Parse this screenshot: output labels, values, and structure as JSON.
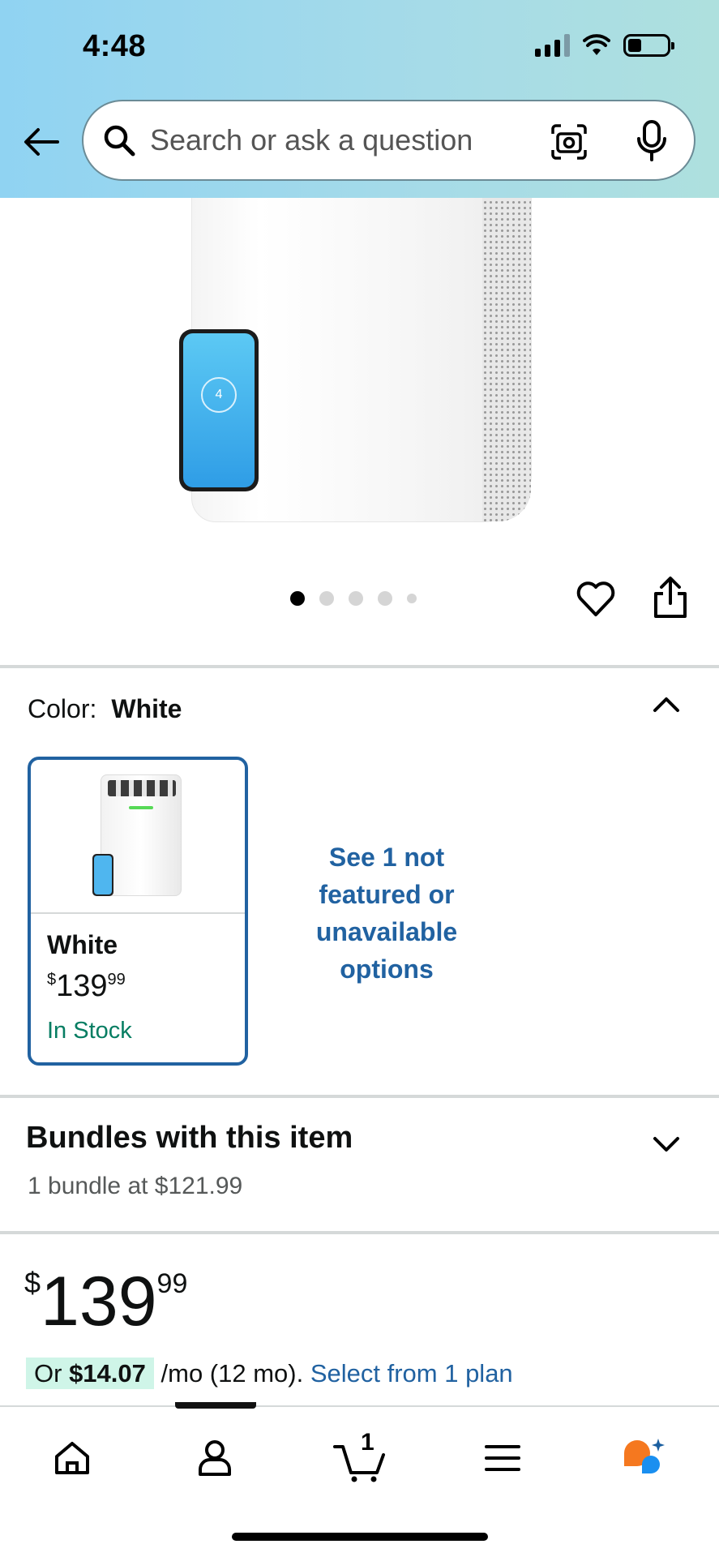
{
  "status_bar": {
    "time": "4:48"
  },
  "search": {
    "placeholder": "Search or ask a question"
  },
  "gallery": {
    "image_count": 5,
    "active_index": 0,
    "phone_reading": "4"
  },
  "color_section": {
    "label": "Color:",
    "selected": "White",
    "options": [
      {
        "name": "White",
        "price_whole": "139",
        "price_cents": "99",
        "price_currency": "$",
        "availability": "In Stock"
      }
    ],
    "see_more": "See 1 not featured or unavailable options"
  },
  "bundles": {
    "title": "Bundles with this item",
    "subtitle": "1 bundle at $121.99"
  },
  "price": {
    "currency": "$",
    "whole": "139",
    "cents": "99",
    "installment_prefix": "Or ",
    "installment_amount": "$14.07",
    "installment_terms": " /mo (12 mo). ",
    "installment_link": "Select from 1 plan"
  },
  "bottom_nav": {
    "cart_count": "1",
    "active": "profile"
  },
  "colors": {
    "link_blue": "#2162a1",
    "in_stock_green": "#067d62",
    "header_gradient_start": "#90d3f2",
    "rufus_orange": "#f5781f",
    "rufus_blue": "#1a8ff0"
  }
}
